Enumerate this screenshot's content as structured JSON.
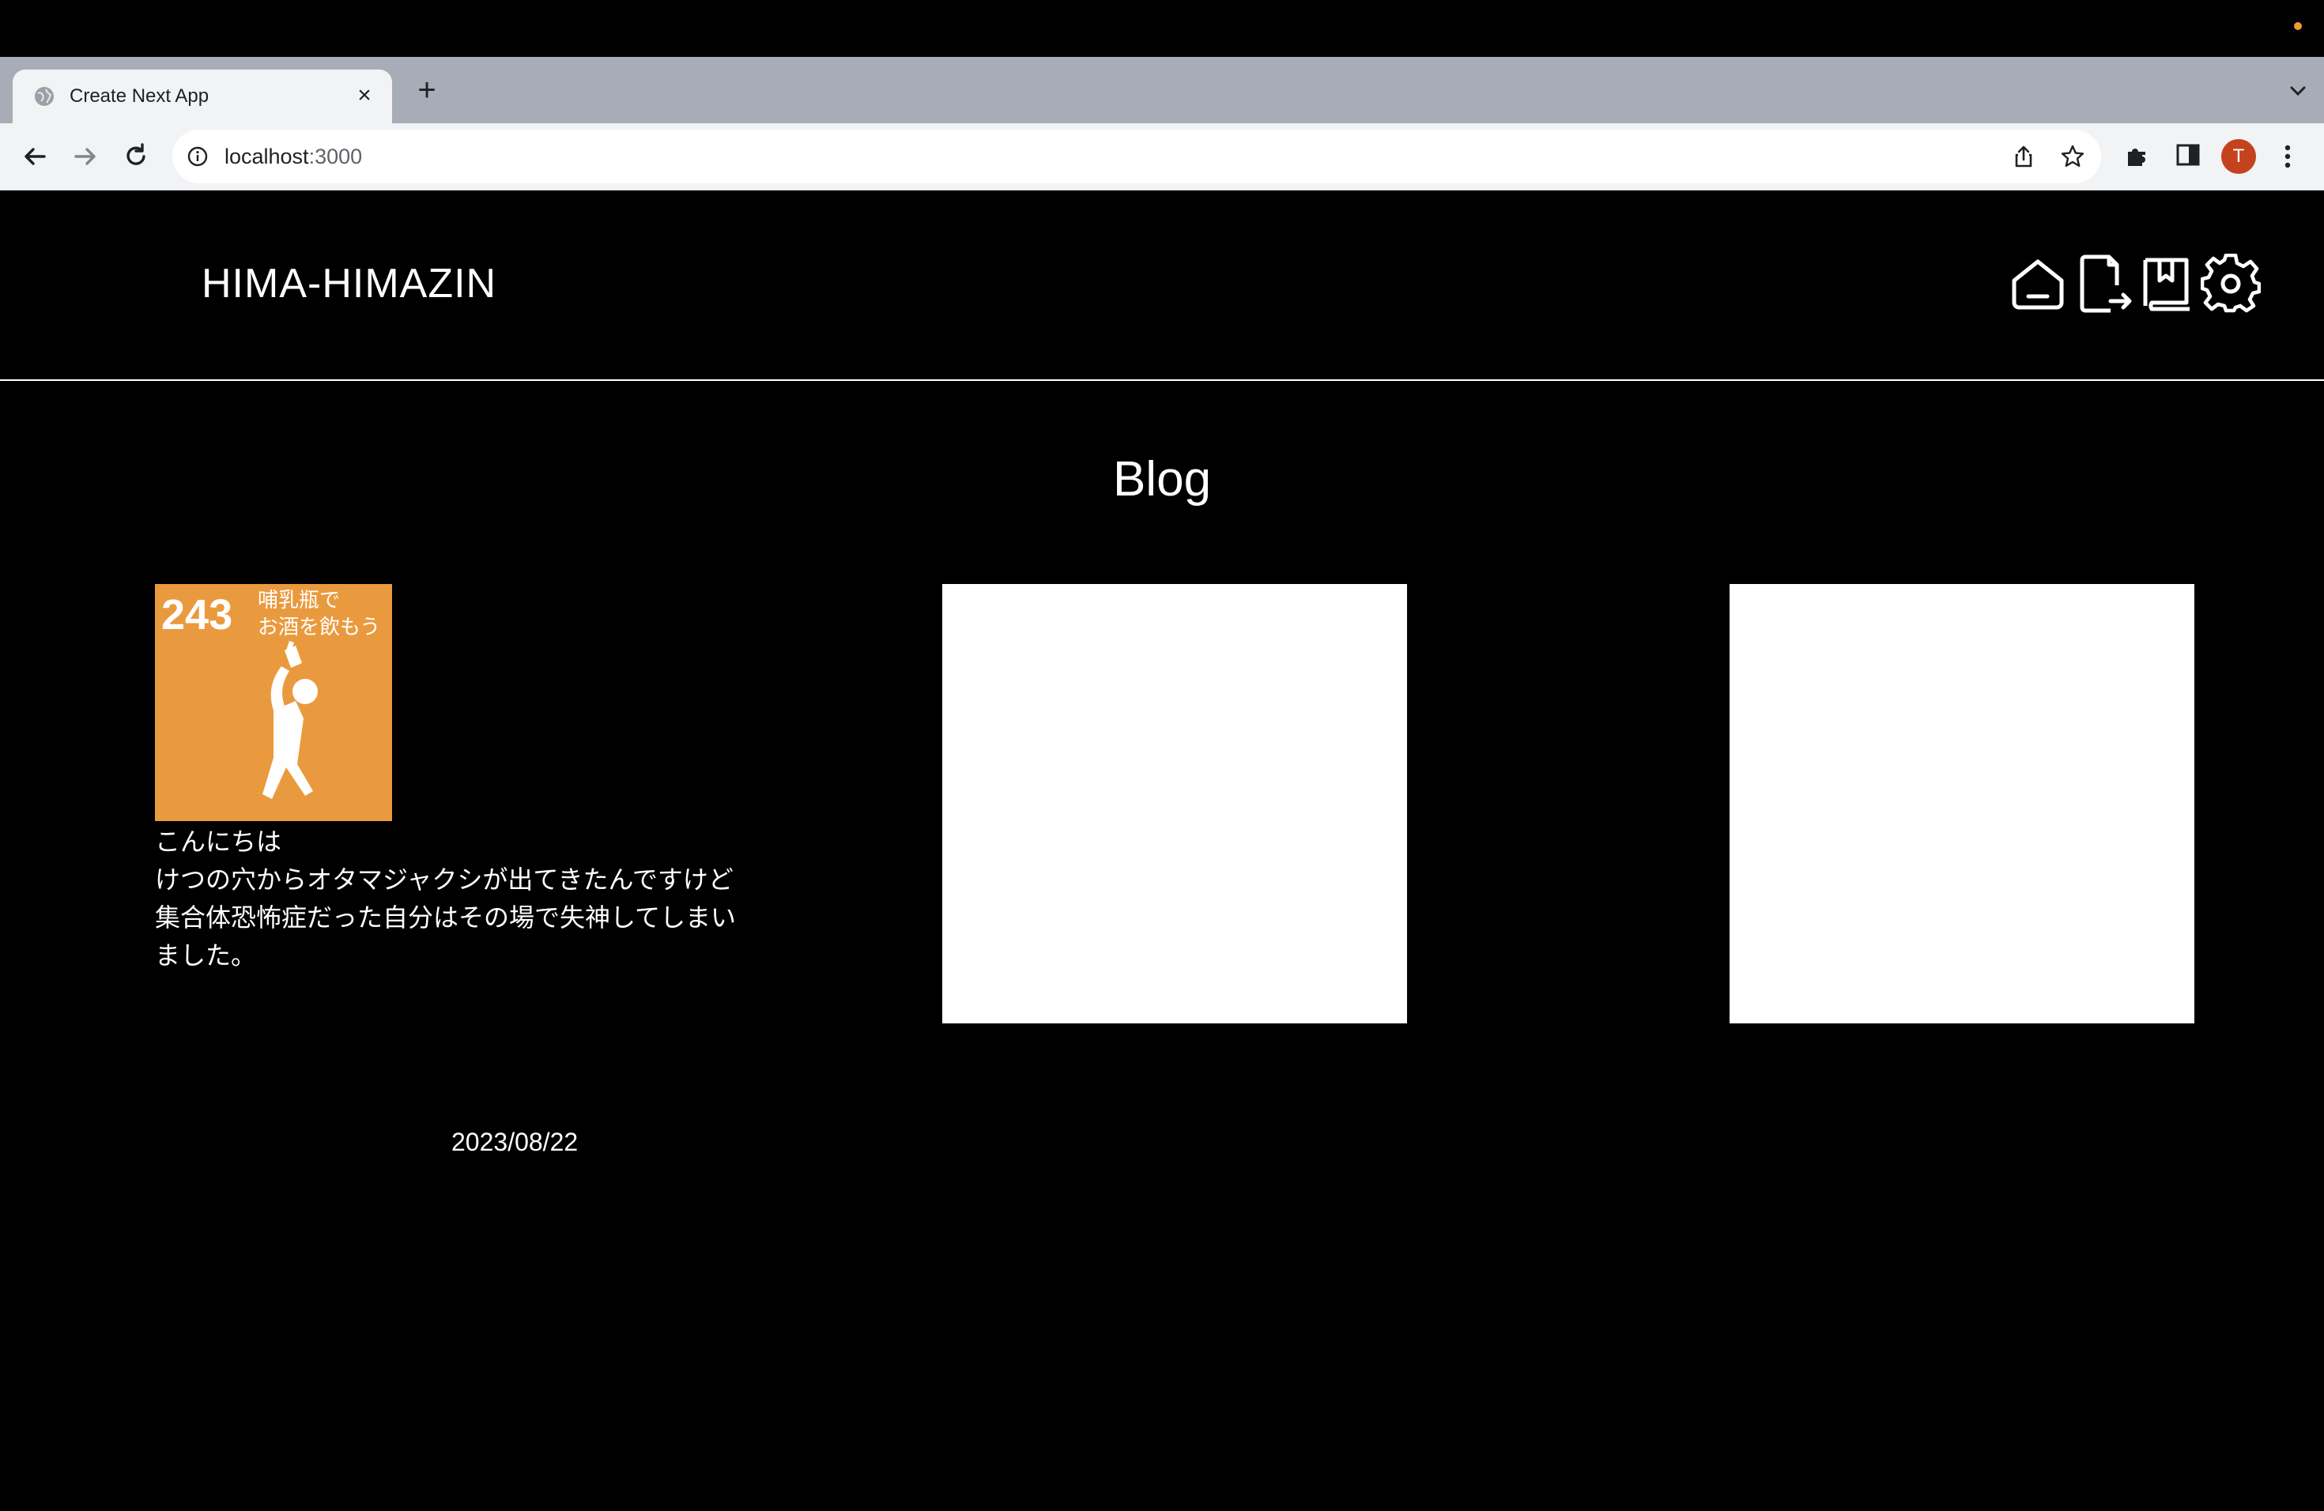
{
  "browser": {
    "tab_title": "Create Next App",
    "new_tab_symbol": "+",
    "close_symbol": "×",
    "url_host": "localhost",
    "url_port": ":3000",
    "avatar_initial": "T",
    "avatar_color": "#c5421f",
    "os_indicator_color": "#f29a37"
  },
  "site": {
    "title": "HIMA-HIMAZIN",
    "nav": [
      {
        "name": "home-icon"
      },
      {
        "name": "file-export-icon"
      },
      {
        "name": "bookmark-icon"
      },
      {
        "name": "gear-icon"
      }
    ]
  },
  "main": {
    "heading": "Blog",
    "posts": [
      {
        "thumbnail": {
          "number": "243",
          "caption_line1": "哺乳瓶で",
          "caption_line2": "お酒を飲もう",
          "background": "#ea9a3e"
        },
        "text": "こんにちは\nけつの穴からオタマジャクシが出てきたんですけど集合体恐怖症だった自分はその場で失神してしまいました。",
        "date": "2023/08/22"
      },
      {
        "placeholder": true
      },
      {
        "placeholder": true
      }
    ]
  }
}
